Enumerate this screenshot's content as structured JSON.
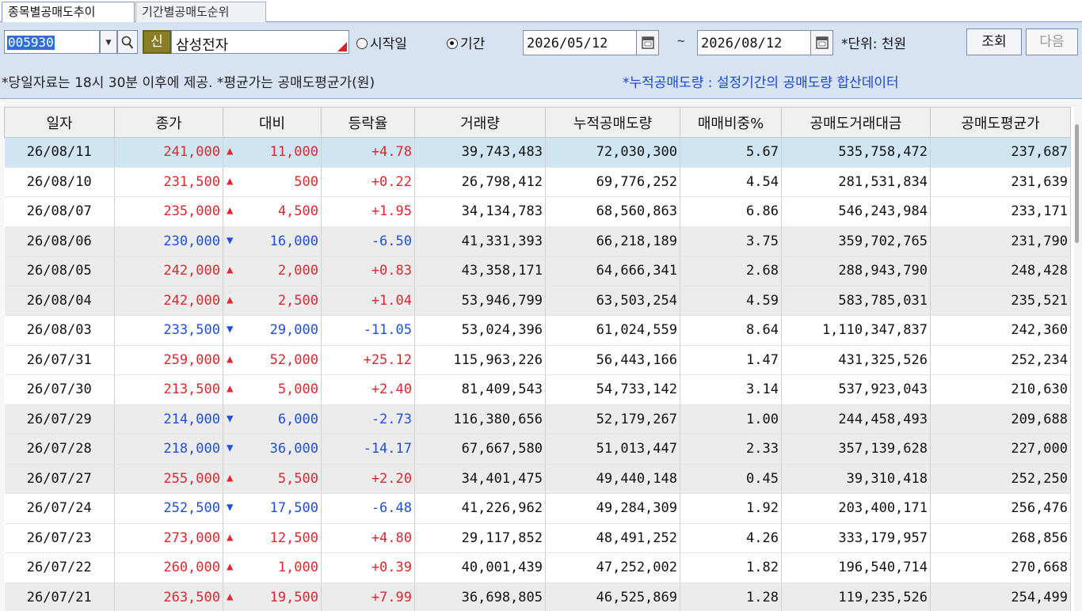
{
  "tabs": [
    {
      "label": "종목별공매도추이",
      "active": true
    },
    {
      "label": "기간별공매도순위",
      "active": false
    }
  ],
  "controls": {
    "code": "005930",
    "badge": "신",
    "stock_name": "삼성전자",
    "radio_start_label": "○시작일",
    "radio_start_text": "시작일",
    "radio_period_text": "기간",
    "date_from": "2026/05/12",
    "tilde": "~",
    "date_to": "2026/08/12",
    "unit_label": "*단위: 천원",
    "query_label": "조회",
    "next_label": "다음"
  },
  "notice": {
    "main": "*당일자료는 18시 30분 이후에 제공. *평균가는 공매도평균가(원)",
    "highlight": "*누적공매도량 : 설정기간의 공매도량 합산데이터"
  },
  "colors": {
    "up": "#e0262e",
    "down": "#1f4fd6",
    "selected_row": "#cfe6f2",
    "panel_bg": "#d7e3f2"
  },
  "table": {
    "headers": [
      "일자",
      "종가",
      "대비",
      "등락율",
      "거래량",
      "누적공매도량",
      "매매비중%",
      "공매도거래대금",
      "공매도평균가"
    ],
    "rows": [
      {
        "date": "26/08/11",
        "close": "241,000",
        "dir": "up",
        "arrow": "▲",
        "change": "11,000",
        "rate": "+4.78",
        "volume": "39,743,483",
        "cum_short": "72,030,300",
        "ratio": "5.67",
        "short_amount": "535,758,472",
        "short_avg": "237,687",
        "bg": "sel"
      },
      {
        "date": "26/08/10",
        "close": "231,500",
        "dir": "up",
        "arrow": "▲",
        "change": "500",
        "rate": "+0.22",
        "volume": "26,798,412",
        "cum_short": "69,776,252",
        "ratio": "4.54",
        "short_amount": "281,531,834",
        "short_avg": "231,639",
        "bg": "white"
      },
      {
        "date": "26/08/07",
        "close": "235,000",
        "dir": "up",
        "arrow": "▲",
        "change": "4,500",
        "rate": "+1.95",
        "volume": "34,134,783",
        "cum_short": "68,560,863",
        "ratio": "6.86",
        "short_amount": "546,243,984",
        "short_avg": "233,171",
        "bg": "white"
      },
      {
        "date": "26/08/06",
        "close": "230,000",
        "dir": "down",
        "arrow": "▼",
        "change": "16,000",
        "rate": "-6.50",
        "volume": "41,331,393",
        "cum_short": "66,218,189",
        "ratio": "3.75",
        "short_amount": "359,702,765",
        "short_avg": "231,790",
        "bg": "gray"
      },
      {
        "date": "26/08/05",
        "close": "242,000",
        "dir": "up",
        "arrow": "▲",
        "change": "2,000",
        "rate": "+0.83",
        "volume": "43,358,171",
        "cum_short": "64,666,341",
        "ratio": "2.68",
        "short_amount": "288,943,790",
        "short_avg": "248,428",
        "bg": "gray"
      },
      {
        "date": "26/08/04",
        "close": "242,000",
        "dir": "up",
        "arrow": "▲",
        "change": "2,500",
        "rate": "+1.04",
        "volume": "53,946,799",
        "cum_short": "63,503,254",
        "ratio": "4.59",
        "short_amount": "583,785,031",
        "short_avg": "235,521",
        "bg": "gray"
      },
      {
        "date": "26/08/03",
        "close": "233,500",
        "dir": "down",
        "arrow": "▼",
        "change": "29,000",
        "rate": "-11.05",
        "volume": "53,024,396",
        "cum_short": "61,024,559",
        "ratio": "8.64",
        "short_amount": "1,110,347,837",
        "short_avg": "242,360",
        "bg": "white"
      },
      {
        "date": "26/07/31",
        "close": "259,000",
        "dir": "up",
        "arrow": "▲",
        "change": "52,000",
        "rate": "+25.12",
        "volume": "115,963,226",
        "cum_short": "56,443,166",
        "ratio": "1.47",
        "short_amount": "431,325,526",
        "short_avg": "252,234",
        "bg": "white"
      },
      {
        "date": "26/07/30",
        "close": "213,500",
        "dir": "up",
        "arrow": "▲",
        "change": "5,000",
        "rate": "+2.40",
        "volume": "81,409,543",
        "cum_short": "54,733,142",
        "ratio": "3.14",
        "short_amount": "537,923,043",
        "short_avg": "210,630",
        "bg": "white"
      },
      {
        "date": "26/07/29",
        "close": "214,000",
        "dir": "down",
        "arrow": "▼",
        "change": "6,000",
        "rate": "-2.73",
        "volume": "116,380,656",
        "cum_short": "52,179,267",
        "ratio": "1.00",
        "short_amount": "244,458,493",
        "short_avg": "209,688",
        "bg": "gray"
      },
      {
        "date": "26/07/28",
        "close": "218,000",
        "dir": "down",
        "arrow": "▼",
        "change": "36,000",
        "rate": "-14.17",
        "volume": "67,667,580",
        "cum_short": "51,013,447",
        "ratio": "2.33",
        "short_amount": "357,139,628",
        "short_avg": "227,000",
        "bg": "gray"
      },
      {
        "date": "26/07/27",
        "close": "255,000",
        "dir": "up",
        "arrow": "▲",
        "change": "5,500",
        "rate": "+2.20",
        "volume": "34,401,475",
        "cum_short": "49,440,148",
        "ratio": "0.45",
        "short_amount": "39,310,418",
        "short_avg": "252,250",
        "bg": "gray"
      },
      {
        "date": "26/07/24",
        "close": "252,500",
        "dir": "down",
        "arrow": "▼",
        "change": "17,500",
        "rate": "-6.48",
        "volume": "41,226,962",
        "cum_short": "49,284,309",
        "ratio": "1.92",
        "short_amount": "203,400,171",
        "short_avg": "256,476",
        "bg": "white"
      },
      {
        "date": "26/07/23",
        "close": "273,000",
        "dir": "up",
        "arrow": "▲",
        "change": "12,500",
        "rate": "+4.80",
        "volume": "29,117,852",
        "cum_short": "48,491,252",
        "ratio": "4.26",
        "short_amount": "333,179,957",
        "short_avg": "268,856",
        "bg": "white"
      },
      {
        "date": "26/07/22",
        "close": "260,000",
        "dir": "up",
        "arrow": "▲",
        "change": "1,000",
        "rate": "+0.39",
        "volume": "40,001,439",
        "cum_short": "47,252,002",
        "ratio": "1.82",
        "short_amount": "196,540,714",
        "short_avg": "270,668",
        "bg": "white"
      },
      {
        "date": "26/07/21",
        "close": "263,500",
        "dir": "up",
        "arrow": "▲",
        "change": "19,500",
        "rate": "+7.99",
        "volume": "36,698,805",
        "cum_short": "46,525,869",
        "ratio": "1.28",
        "short_amount": "119,235,526",
        "short_avg": "254,499",
        "bg": "gray"
      }
    ]
  }
}
